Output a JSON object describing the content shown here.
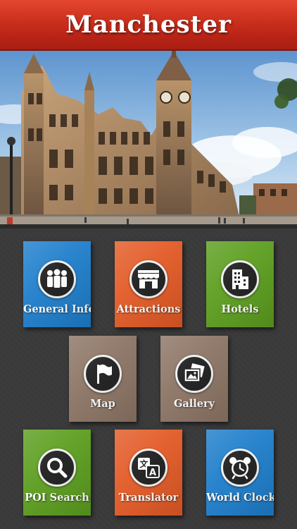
{
  "header": {
    "title": "Manchester"
  },
  "colors": {
    "header_red": "#c42a1a",
    "tile_blue": "#1e7ecb",
    "tile_orange": "#e35a26",
    "tile_green": "#5c9e1f",
    "tile_brown": "#8c7565",
    "background": "#3a3a3a"
  },
  "hero": {
    "image": "manchester-town-hall-photo"
  },
  "tiles": [
    {
      "label": "General Info",
      "icon": "people-icon",
      "color": "blue"
    },
    {
      "label": "Attractions",
      "icon": "storefront-icon",
      "color": "orange"
    },
    {
      "label": "Hotels",
      "icon": "building-icon",
      "color": "green"
    },
    {
      "label": "Map",
      "icon": "flag-icon",
      "color": "brown"
    },
    {
      "label": "Gallery",
      "icon": "photos-icon",
      "color": "brown"
    },
    {
      "label": "POI Search",
      "icon": "magnifier-icon",
      "color": "green"
    },
    {
      "label": "Translator",
      "icon": "translate-icon",
      "color": "orange"
    },
    {
      "label": "World Clock",
      "icon": "alarm-clock-icon",
      "color": "blue"
    }
  ]
}
